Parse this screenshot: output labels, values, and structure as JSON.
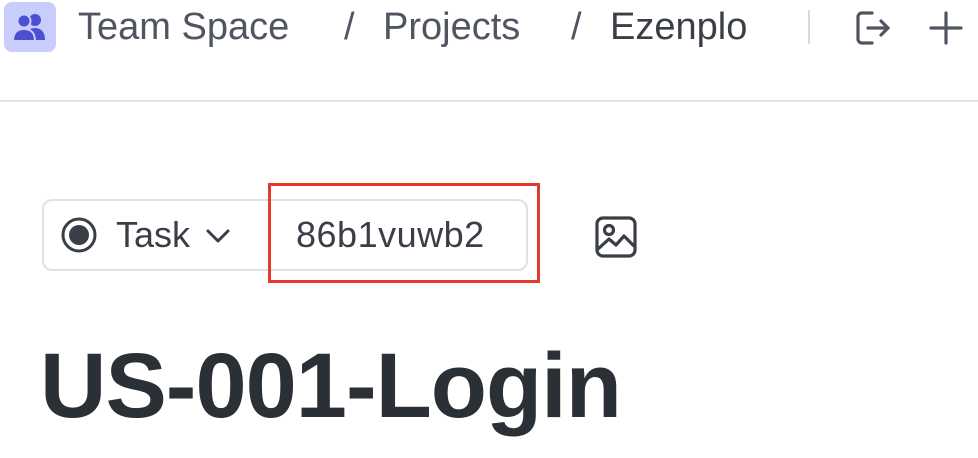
{
  "breadcrumb": {
    "space": "Team Space",
    "separator": "/",
    "folder": "Projects",
    "list": "Ezenplo"
  },
  "header_actions": {
    "share_icon": "export-icon",
    "add_icon": "plus-icon"
  },
  "task": {
    "type_label": "Task",
    "id": "86b1vuwb2",
    "title": "US-001-Login"
  },
  "icons": {
    "space_avatar": "people-icon",
    "task_type": "radio-dot-icon",
    "type_dropdown": "chevron-down-icon",
    "cover": "image-icon"
  },
  "colors": {
    "space_avatar_bg": "#c9cdfb",
    "space_avatar_fg": "#4b4fd1",
    "highlight": "#e23b2e",
    "text": "#2b2f36"
  }
}
